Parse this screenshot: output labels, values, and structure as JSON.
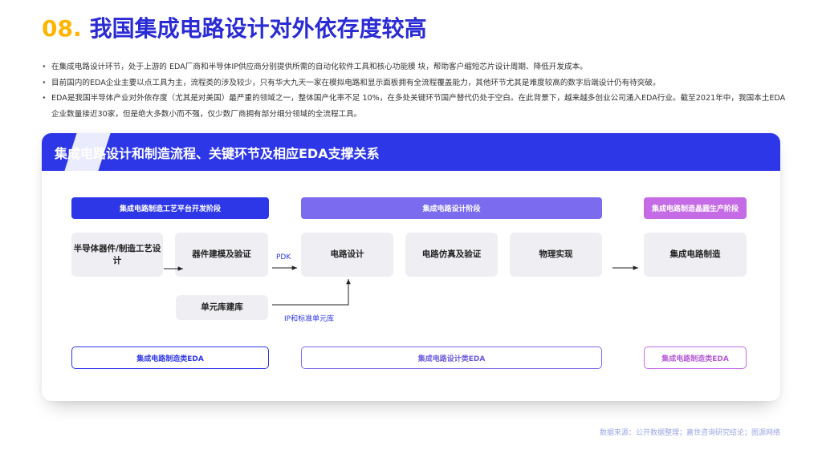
{
  "header": {
    "number": "08.",
    "title": "我国集成电路设计对外依存度较高"
  },
  "bullets": [
    "在集成电路设计环节，处于上游的 EDA厂商和半导体IP供应商分别提供所需的自动化软件工具和核心功能模 块，帮助客户缩短芯片设计周期、降低开发成本。",
    "目前国内的EDA企业主要以点工具为主，流程类的涉及较少，只有华大九天一家在模拟电路和显示面板拥有全流程覆盖能力，其他环节尤其是难度较高的数字后端设计仍有待突破。",
    "EDA是我国半导体产业对外依存度（尤其是对美国）最严重的领域之一，整体国产化率不足 10%，在多处关键环节国产替代仍处于空白。在此背景下，越来越多创业公司涌入EDA行业。截至2021年中，我国本土EDA 企业数量接近30家，但是绝大多数小而不强，仅少数厂商拥有部分细分领域的全流程工具。"
  ],
  "diagram": {
    "heading": "集成电路设计和制造流程、关键环节及相应EDA支撑关系",
    "stages": {
      "process_platform": "集成电路制造工艺平台开发阶段",
      "design": "集成电路设计阶段",
      "wafer": "集成电路制造晶圆生产阶段"
    },
    "nodes": {
      "device_process": "半导体器件/制造工艺设计",
      "device_modeling": "器件建模及验证",
      "circuit_design": "电路设计",
      "simulation": "电路仿真及验证",
      "physical": "物理实现",
      "manufacturing": "集成电路制造",
      "cell_library": "单元库建库"
    },
    "labels": {
      "pdk": "PDK",
      "ip": "IP和标准单元库"
    },
    "eda": {
      "manufacturing_eda": "集成电路制造类EDA",
      "design_eda": "集成电路设计类EDA",
      "wafer_eda": "集成电路制造类EDA"
    }
  },
  "colors": {
    "brand_blue": "#2E37E8",
    "title_blue": "#2B2BD6",
    "number_yellow": "#FFB400",
    "stage_design_purple": "#7A6BEF",
    "stage_wafer_magenta": "#C56BE6",
    "node_gray": "#EFEFF3"
  },
  "source": "数据来源：公开数据整理；嘉世咨询研究结论；图源网络"
}
